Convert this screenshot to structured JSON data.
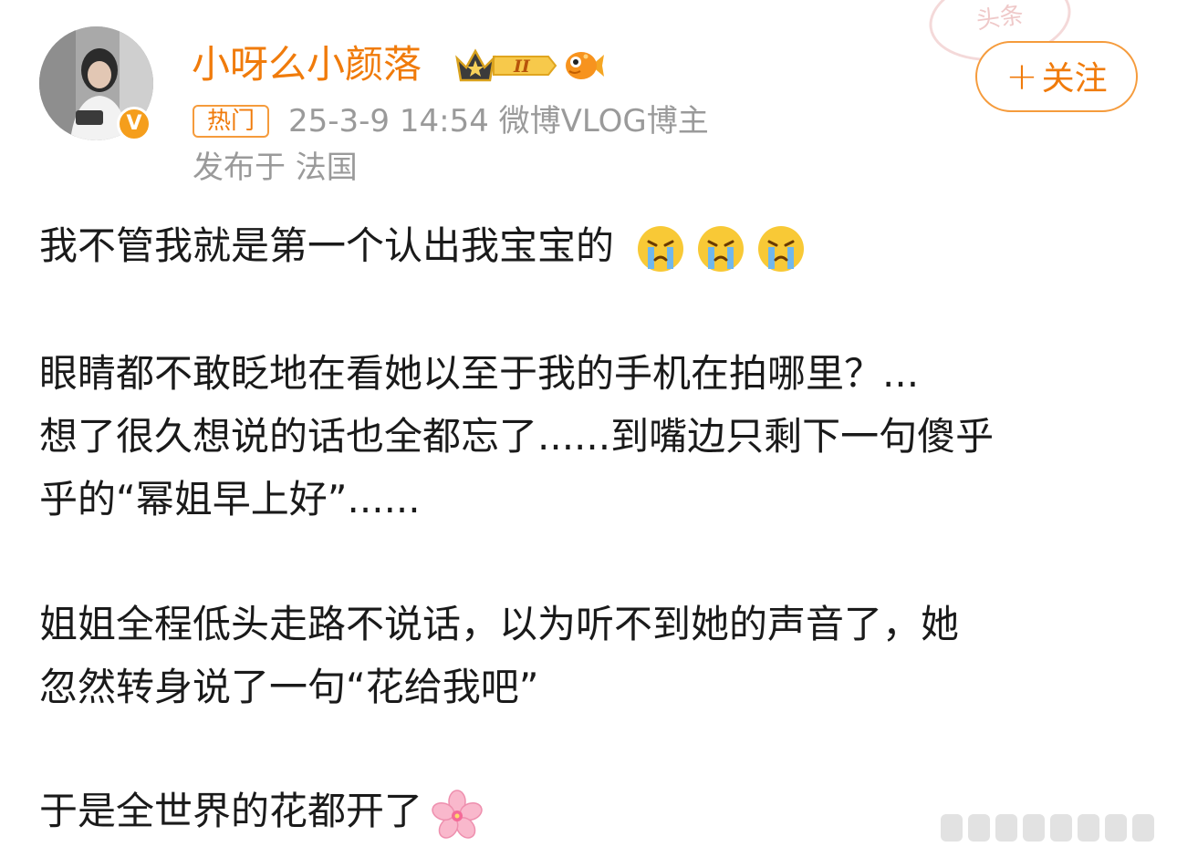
{
  "stamp": {
    "text": "头条"
  },
  "header": {
    "username": "小呀么小颜落",
    "level_badge": "II",
    "avatar_badge": "V",
    "hot_tag": "热门",
    "meta": "25-3-9 14:54  微博VLOG博主",
    "location": "发布于 法国",
    "follow_plus": "+",
    "follow_label": "关注"
  },
  "post": {
    "line1": "我不管我就是第一个认出我宝宝的",
    "line2": "眼睛都不敢眨地在看她以至于我的手机在拍哪里？...",
    "line3": "想了很久想说的话也全都忘了......到嘴边只剩下一句傻乎",
    "line4": "乎的“幂姐早上好”......",
    "line5": "姐姐全程低头走路不说话，以为听不到她的声音了，她",
    "line6": "忽然转身说了一句“花给我吧”",
    "line7": "于是全世界的花都开了"
  },
  "icons": {
    "crying_emoji": "crying-face-icon",
    "blossom_emoji": "cherry-blossom-icon",
    "crown": "crown-icon",
    "fish": "fish-icon",
    "more": "more-dots-icon"
  },
  "colors": {
    "accent": "#f07b0b",
    "border_accent": "#f59b3c",
    "meta_gray": "#9a9a9a",
    "body_text": "#1a1a1a",
    "verified": "#f59e1c"
  }
}
